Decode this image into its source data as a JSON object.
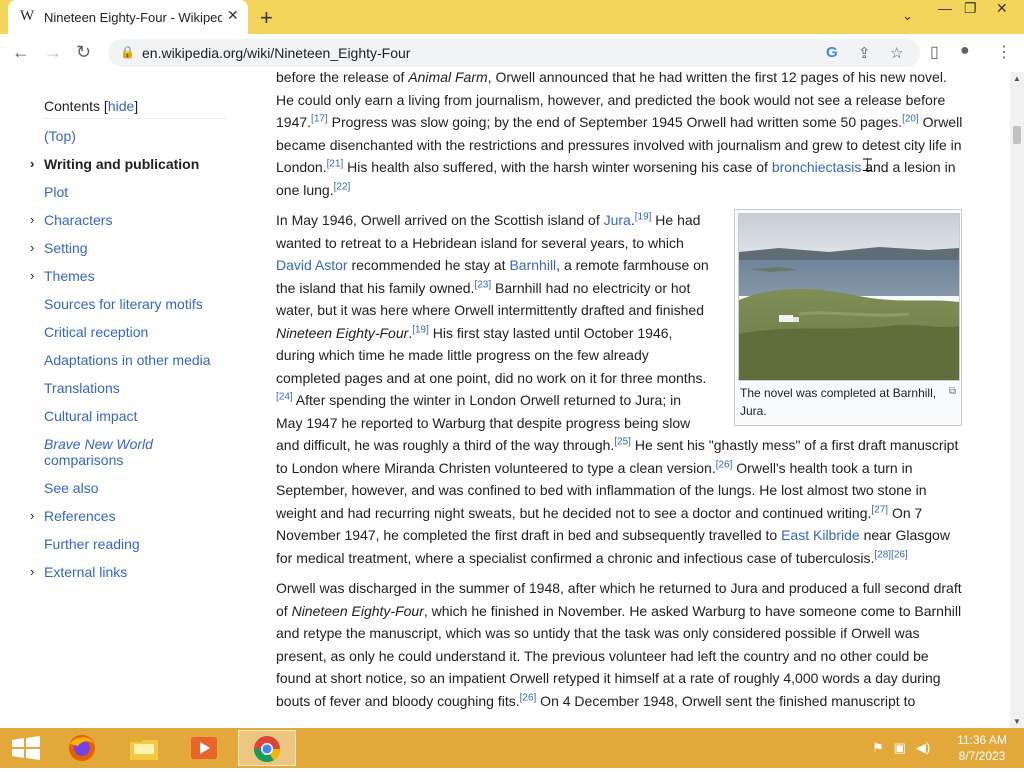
{
  "browser": {
    "tab_title": "Nineteen Eighty-Four - Wikipedia",
    "tab_favicon": "W",
    "url": "en.wikipedia.org/wiki/Nineteen_Eighty-Four"
  },
  "toc": {
    "title": "Contents",
    "hide_label": "hide",
    "items": [
      {
        "label": "(Top)",
        "expandable": false
      },
      {
        "label": "Writing and publication",
        "expandable": true,
        "active": true
      },
      {
        "label": "Plot",
        "expandable": false
      },
      {
        "label": "Characters",
        "expandable": true
      },
      {
        "label": "Setting",
        "expandable": true
      },
      {
        "label": "Themes",
        "expandable": true
      },
      {
        "label": "Sources for literary motifs",
        "expandable": false
      },
      {
        "label": "Critical reception",
        "expandable": false
      },
      {
        "label": "Adaptations in other media",
        "expandable": false
      },
      {
        "label": "Translations",
        "expandable": false
      },
      {
        "label": "Cultural impact",
        "expandable": false
      },
      {
        "label": "Brave New World",
        "label2": "comparisons",
        "expandable": false
      },
      {
        "label": "See also",
        "expandable": false
      },
      {
        "label": "References",
        "expandable": true
      },
      {
        "label": "Further reading",
        "expandable": false
      },
      {
        "label": "External links",
        "expandable": true
      }
    ]
  },
  "article": {
    "p1": {
      "t1": "before the release of ",
      "i1": "Animal Farm",
      "t2": ", Orwell announced that he had written the first 12 pages of his new novel. He could only earn a living from journalism, however, and predicted the book would not see a release before 1947.",
      "r1": "[17]",
      "t3": " Progress was slow going; by the end of September 1945 Orwell had written some 50 pages.",
      "r2": "[20]",
      "t4": " Orwell became disenchanted with the restrictions and pressures involved with journalism and grew to detest city life in London.",
      "r3": "[21]",
      "t5": " His health also suffered, with the harsh winter worsening his case of ",
      "l1": "bronchiectasis",
      "t6": " and a lesion in one lung.",
      "r4": "[22]"
    },
    "p2": {
      "t1": "In May 1946, Orwell arrived on the Scottish island of ",
      "l1": "Jura",
      "t1b": ".",
      "r1": "[19]",
      "t2": " He had wanted to retreat to a Hebridean island for several years, to which ",
      "l2": "David Astor",
      "t3": " recommended he stay at ",
      "l3": "Barnhill",
      "t4": ", a remote farmhouse on the island that his family owned.",
      "r2": "[23]",
      "t5": " Barnhill had no electricity or hot water, but it was here where Orwell intermittently drafted and finished ",
      "i1": "Nineteen Eighty-Four",
      "t5b": ".",
      "r3": "[19]",
      "t6": " His first stay lasted until October 1946, during which time he made little progress on the few already completed pages and at one point, did no work on it for three months.",
      "r4": "[24]",
      "t7": " After spending the winter in London Orwell returned to Jura; in May 1947 he reported to Warburg that despite progress being slow and difficult, he was roughly a third of the way through.",
      "r5": "[25]",
      "t8": " He sent his \"ghastly mess\" of a first draft manuscript to London where Miranda Christen volunteered to type a clean version.",
      "r6": "[26]",
      "t9": " Orwell's health took a turn in September, however, and was confined to bed with inflammation of the lungs. He lost almost two stone in weight and had recurring night sweats, but he decided not to see a doctor and continued writing.",
      "r7": "[27]",
      "t10": " On 7 November 1947, he completed the first draft in bed and subsequently travelled to ",
      "l4": "East Kilbride",
      "t11": " near Glasgow for medical treatment, where a specialist confirmed a chronic and infectious case of tuberculosis.",
      "r8": "[28][26]"
    },
    "p3": {
      "t1": "Orwell was discharged in the summer of 1948, after which he returned to Jura and produced a full second draft of ",
      "i1": "Nineteen Eighty-Four",
      "t2": ", which he finished in November. He asked Warburg to have someone come to Barnhill and retype the manuscript, which was so untidy that the task was only considered possible if Orwell was present, as only he could understand it. The previous volunteer had left the country and no other could be found at short notice, so an impatient Orwell retyped it himself at a rate of roughly 4,000 words a day during bouts of fever and bloody coughing fits.",
      "r1": "[26]",
      "t3": " On 4 December 1948, Orwell sent the finished manuscript to"
    },
    "image_caption": "The novel was completed at Barnhill, Jura."
  },
  "taskbar": {
    "time": "11:36 AM",
    "date": "8/7/2023"
  },
  "colors": {
    "tabstrip": "#f4d55c",
    "taskbar": "#e2a83a",
    "link": "#3366cc"
  }
}
